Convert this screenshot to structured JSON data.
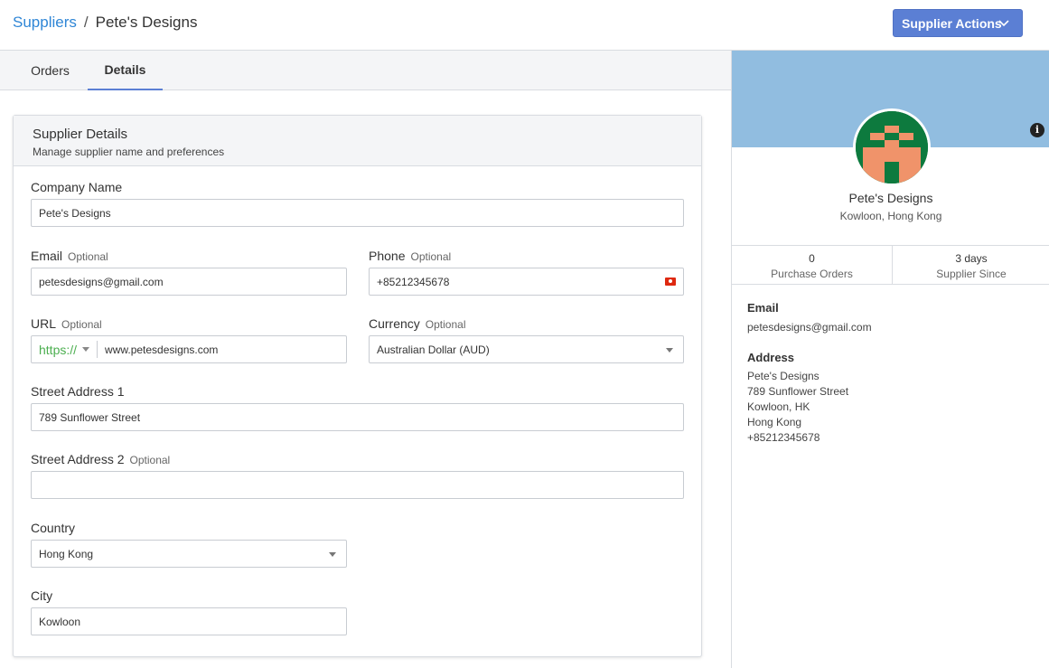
{
  "breadcrumb": {
    "root": "Suppliers",
    "separator": "/",
    "current": "Pete's Designs"
  },
  "header": {
    "actions_label": "Supplier Actions",
    "actions_icon": "chevron-down-icon"
  },
  "tabs": [
    {
      "label": "Orders",
      "active": false
    },
    {
      "label": "Details",
      "active": true
    }
  ],
  "card": {
    "title": "Supplier Details",
    "subtitle": "Manage supplier name and preferences"
  },
  "form": {
    "company_name": {
      "label": "Company Name",
      "value": "Pete's Designs"
    },
    "email": {
      "label": "Email",
      "optional": "Optional",
      "value": "petesdesigns@gmail.com"
    },
    "phone": {
      "label": "Phone",
      "optional": "Optional",
      "value": "+85212345678",
      "flag_icon": "hong-kong-flag-icon"
    },
    "url": {
      "label": "URL",
      "optional": "Optional",
      "protocol": "https://",
      "value": "www.petesdesigns.com"
    },
    "currency": {
      "label": "Currency",
      "optional": "Optional",
      "value": "Australian Dollar (AUD)"
    },
    "street1": {
      "label": "Street Address 1",
      "value": "789 Sunflower Street"
    },
    "street2": {
      "label": "Street Address 2",
      "optional": "Optional",
      "value": ""
    },
    "country": {
      "label": "Country",
      "value": "Hong Kong"
    },
    "city": {
      "label": "City",
      "value": "Kowloon"
    }
  },
  "profile": {
    "name": "Pete's Designs",
    "location": "Kowloon, Hong Kong",
    "cover_color": "#91bde0",
    "avatar_colors": {
      "background": "#0d7a3e",
      "foreground": "#f0936a"
    },
    "stats": [
      {
        "value": "0",
        "label": "Purchase Orders"
      },
      {
        "value": "3 days",
        "label": "Supplier Since"
      }
    ],
    "email_title": "Email",
    "email": "petesdesigns@gmail.com",
    "address_title": "Address",
    "address_lines": [
      "Pete's Designs",
      "789 Sunflower Street",
      "Kowloon, HK",
      "Hong Kong",
      "+85212345678"
    ]
  },
  "colors": {
    "accent": "#5b7fd4",
    "link": "#2f86d6",
    "protocol": "#4caf50"
  }
}
